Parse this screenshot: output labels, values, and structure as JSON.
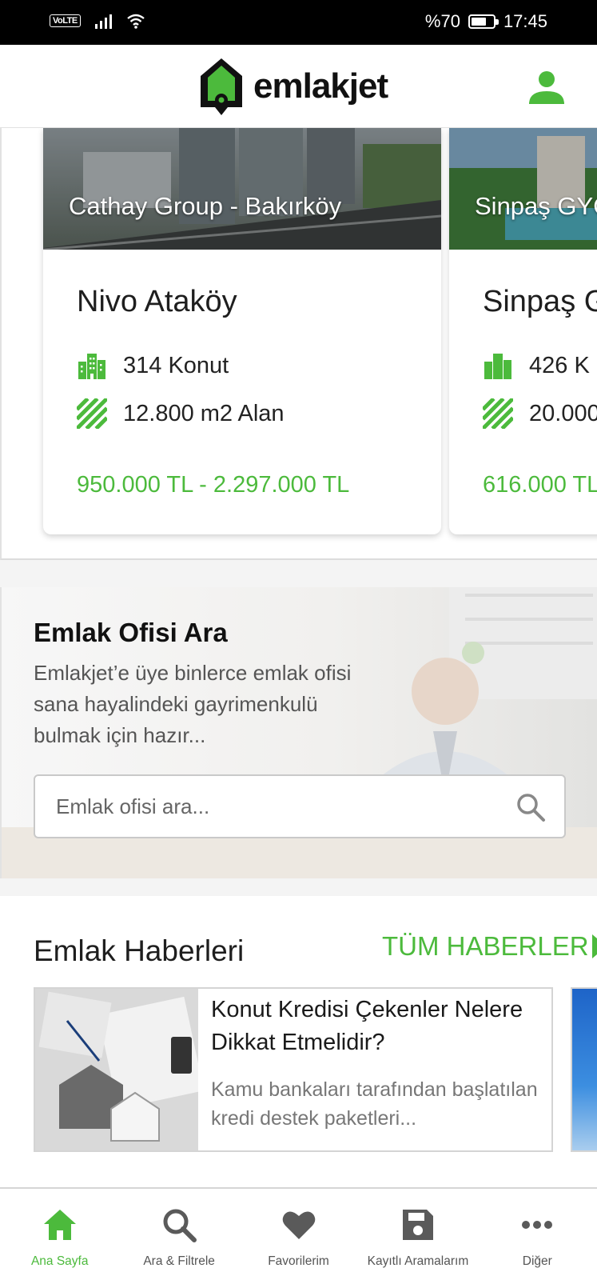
{
  "status_bar": {
    "network_badge": "VoLTE",
    "battery_text": "%70",
    "battery_level": 0.7,
    "time": "17:45"
  },
  "header": {
    "logo_text": "emlakjet",
    "accent_color": "#4cba3c"
  },
  "projects": [
    {
      "developer_label": "Cathay Group - Bakırköy",
      "name": "Nivo Ataköy",
      "units": "314 Konut",
      "area": "12.800 m2 Alan",
      "price_range": "950.000 TL - 2.297.000 TL"
    },
    {
      "developer_label": "Sinpaş GYO",
      "name": "Sinpaş G",
      "units": "426 K",
      "area": "20.000",
      "price_range": "616.000 TL"
    }
  ],
  "office_search": {
    "title": "Emlak Ofisi Ara",
    "description": "Emlakjet’e üye binlerce emlak ofisi sana hayalindeki gayrimenkulü bulmak için hazır...",
    "placeholder": "Emlak ofisi ara..."
  },
  "news": {
    "section_title": "Emlak Haberleri",
    "all_link": "TÜM HABERLER",
    "items": [
      {
        "headline": "Konut Kredisi Çekenler Nelere Dikkat Etmelidir?",
        "summary": "Kamu bankaları tarafından başlatılan kredi destek paketleri..."
      }
    ]
  },
  "bottom_nav": {
    "items": [
      {
        "label": "Ana Sayfa",
        "icon": "home-icon",
        "active": true
      },
      {
        "label": "Ara & Filtrele",
        "icon": "search-icon",
        "active": false
      },
      {
        "label": "Favorilerim",
        "icon": "heart-icon",
        "active": false
      },
      {
        "label": "Kayıtlı Aramalarım",
        "icon": "save-icon",
        "active": false
      },
      {
        "label": "Diğer",
        "icon": "more-icon",
        "active": false
      }
    ]
  }
}
